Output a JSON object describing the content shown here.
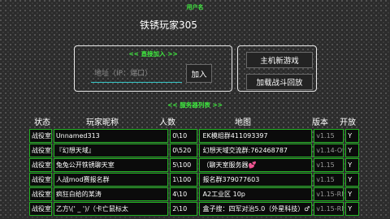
{
  "header": {
    "username_label": "用户名",
    "username": "铁锈玩家305"
  },
  "direct_join": {
    "title": "<< 直接加入 >>",
    "address_placeholder": "地址（IP：端口）",
    "join_label": "加入"
  },
  "host_panel": {
    "host_game_label": "主机新游戏",
    "load_replay_label": "加载战斗回放"
  },
  "server_list": {
    "title": "<< 服务器列表 >>",
    "columns": {
      "status": "状态",
      "nickname": "玩家昵称",
      "count": "人数",
      "map": "地图",
      "version": "版本",
      "open": "开放"
    },
    "rows": [
      {
        "status": "战役室",
        "nickname": "Unnamed313",
        "count": "0\\10",
        "map": "EK模组群411093397",
        "version": "v1.15",
        "open": "Y"
      },
      {
        "status": "战役室",
        "nickname": "『幻想天域』",
        "count": "0\\520",
        "map": "幻想天域交流群:762468787",
        "version": "v1.14-Oth",
        "open": "Y"
      },
      {
        "status": "战役室",
        "nickname": "兔兔公开铁锈聊天室",
        "count": "5\\100",
        "map": "（聊天室服务器💕",
        "version": "v1.15",
        "open": "Y"
      },
      {
        "status": "战役室",
        "nickname": "人战mod赛报名群",
        "count": "1\\100",
        "map": "报名群379077603",
        "version": "v1.15",
        "open": "Y"
      },
      {
        "status": "战役室",
        "nickname": "疯狂白给的某涛",
        "count": "4\\10",
        "map": "A2工业区 10p",
        "version": "v1.15-RN-",
        "open": "Y"
      },
      {
        "status": "战役室",
        "nickname": "乙方\\(' _ ')/（卡亡鼠标太",
        "count": "2\\10",
        "map": "盒子搜：四军对治5.0（外星科技）♂",
        "version": "v1.15-RN-",
        "open": "Y"
      }
    ]
  }
}
